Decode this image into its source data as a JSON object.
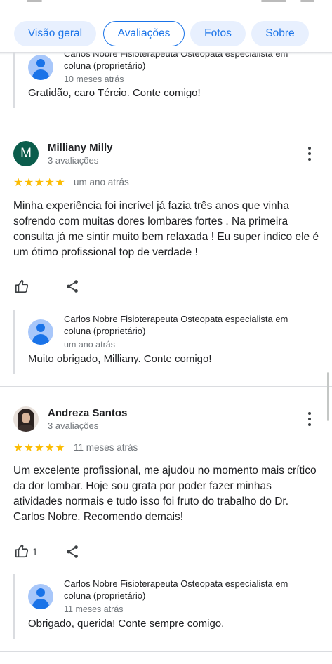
{
  "tabs": [
    {
      "label": "Visão geral",
      "active": false
    },
    {
      "label": "Avaliações",
      "active": true
    },
    {
      "label": "Fotos",
      "active": false
    },
    {
      "label": "Sobre",
      "active": false
    }
  ],
  "colors": {
    "accent": "#1a73e8",
    "star": "#fbbc04",
    "avatar_m": "#0b5d4c"
  },
  "owner_name": "Carlos Nobre Fisioterapeuta Osteopata especialista em coluna (proprietário)",
  "top_reply": {
    "time": "10 meses atrás",
    "text": "Gratidão, caro Tércio. Conte comigo!"
  },
  "reviews": [
    {
      "avatar_letter": "M",
      "name": "Milliany Milly",
      "count": "3 avaliações",
      "stars": "★★★★★",
      "rating": 5,
      "time": "um ano atrás",
      "text": "Minha experiência foi incrível já fazia três anos que vinha sofrendo com muitas dores lombares fortes . Na primeira consulta já me sintir muito bem relaxada ! Eu super indico ele é um ótimo profissional top de verdade !",
      "likes": "",
      "reply": {
        "time": "um ano atrás",
        "text": "Muito obrigado, Milliany. Conte comigo!"
      }
    },
    {
      "avatar_letter": "",
      "name": "Andreza Santos",
      "count": "3 avaliações",
      "stars": "★★★★★",
      "rating": 5,
      "time": "11 meses atrás",
      "text": "Um excelente profissional, me ajudou no momento mais crítico da dor lombar. Hoje sou grata por poder fazer minhas atividades normais e tudo isso foi fruto do trabalho do Dr. Carlos Nobre. Recomendo demais!",
      "likes": "1",
      "reply": {
        "time": "11 meses atrás",
        "text": "Obrigado, querida! Conte sempre comigo."
      }
    }
  ],
  "icons": {
    "like": "thumb-up-icon",
    "share": "share-icon",
    "more": "more-vert-icon",
    "avatar": "account-circle-icon"
  }
}
